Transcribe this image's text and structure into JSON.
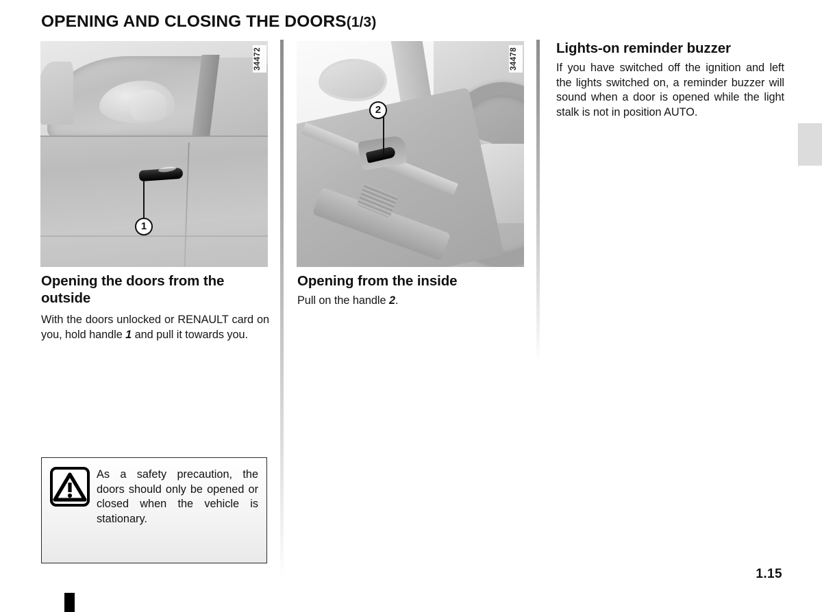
{
  "page": {
    "title_main": "OPENING AND CLOSING THE DOORS",
    "title_fraction": "(1/3)",
    "number": "1.15"
  },
  "figures": [
    {
      "name": "exterior-door-handle",
      "reference": "34472",
      "callout": "1",
      "description": "Exterior view of car front door with door handle"
    },
    {
      "name": "interior-door-handle",
      "reference": "34478",
      "callout": "2",
      "description": "Interior view of driver door trim with inside handle and steering wheel"
    }
  ],
  "columns": {
    "left": {
      "heading": "Opening the doors from the outside",
      "body_parts": [
        {
          "text": "With the doors unlocked or RENAULT card on you, hold handle "
        },
        {
          "text": "1",
          "bold": true
        },
        {
          "text": " and pull it towards you."
        }
      ],
      "body_plain": "With the doors unlocked or RENAULT card on you, hold handle 1 and pull it towards you."
    },
    "middle": {
      "heading": "Opening from the inside",
      "body_parts": [
        {
          "text": "Pull on the handle "
        },
        {
          "text": "2",
          "bold": true
        },
        {
          "text": "."
        }
      ],
      "body_plain": "Pull on the handle 2."
    },
    "right": {
      "heading": "Lights-on reminder buzzer",
      "body_plain": "If you have switched off the ignition and left the lights switched on, a reminder buzzer will sound when a door is opened while the light stalk is not in position AUTO."
    }
  },
  "warning": {
    "icon": "warning-triangle-icon",
    "text": "As a safety precaution, the doors should only be opened or closed when the vehicle is stationary."
  },
  "colors": {
    "text": "#111111",
    "rule": "#8d8d8d",
    "edge_tab": "#dcdcdc",
    "warning_border": "#2a2a2a"
  }
}
